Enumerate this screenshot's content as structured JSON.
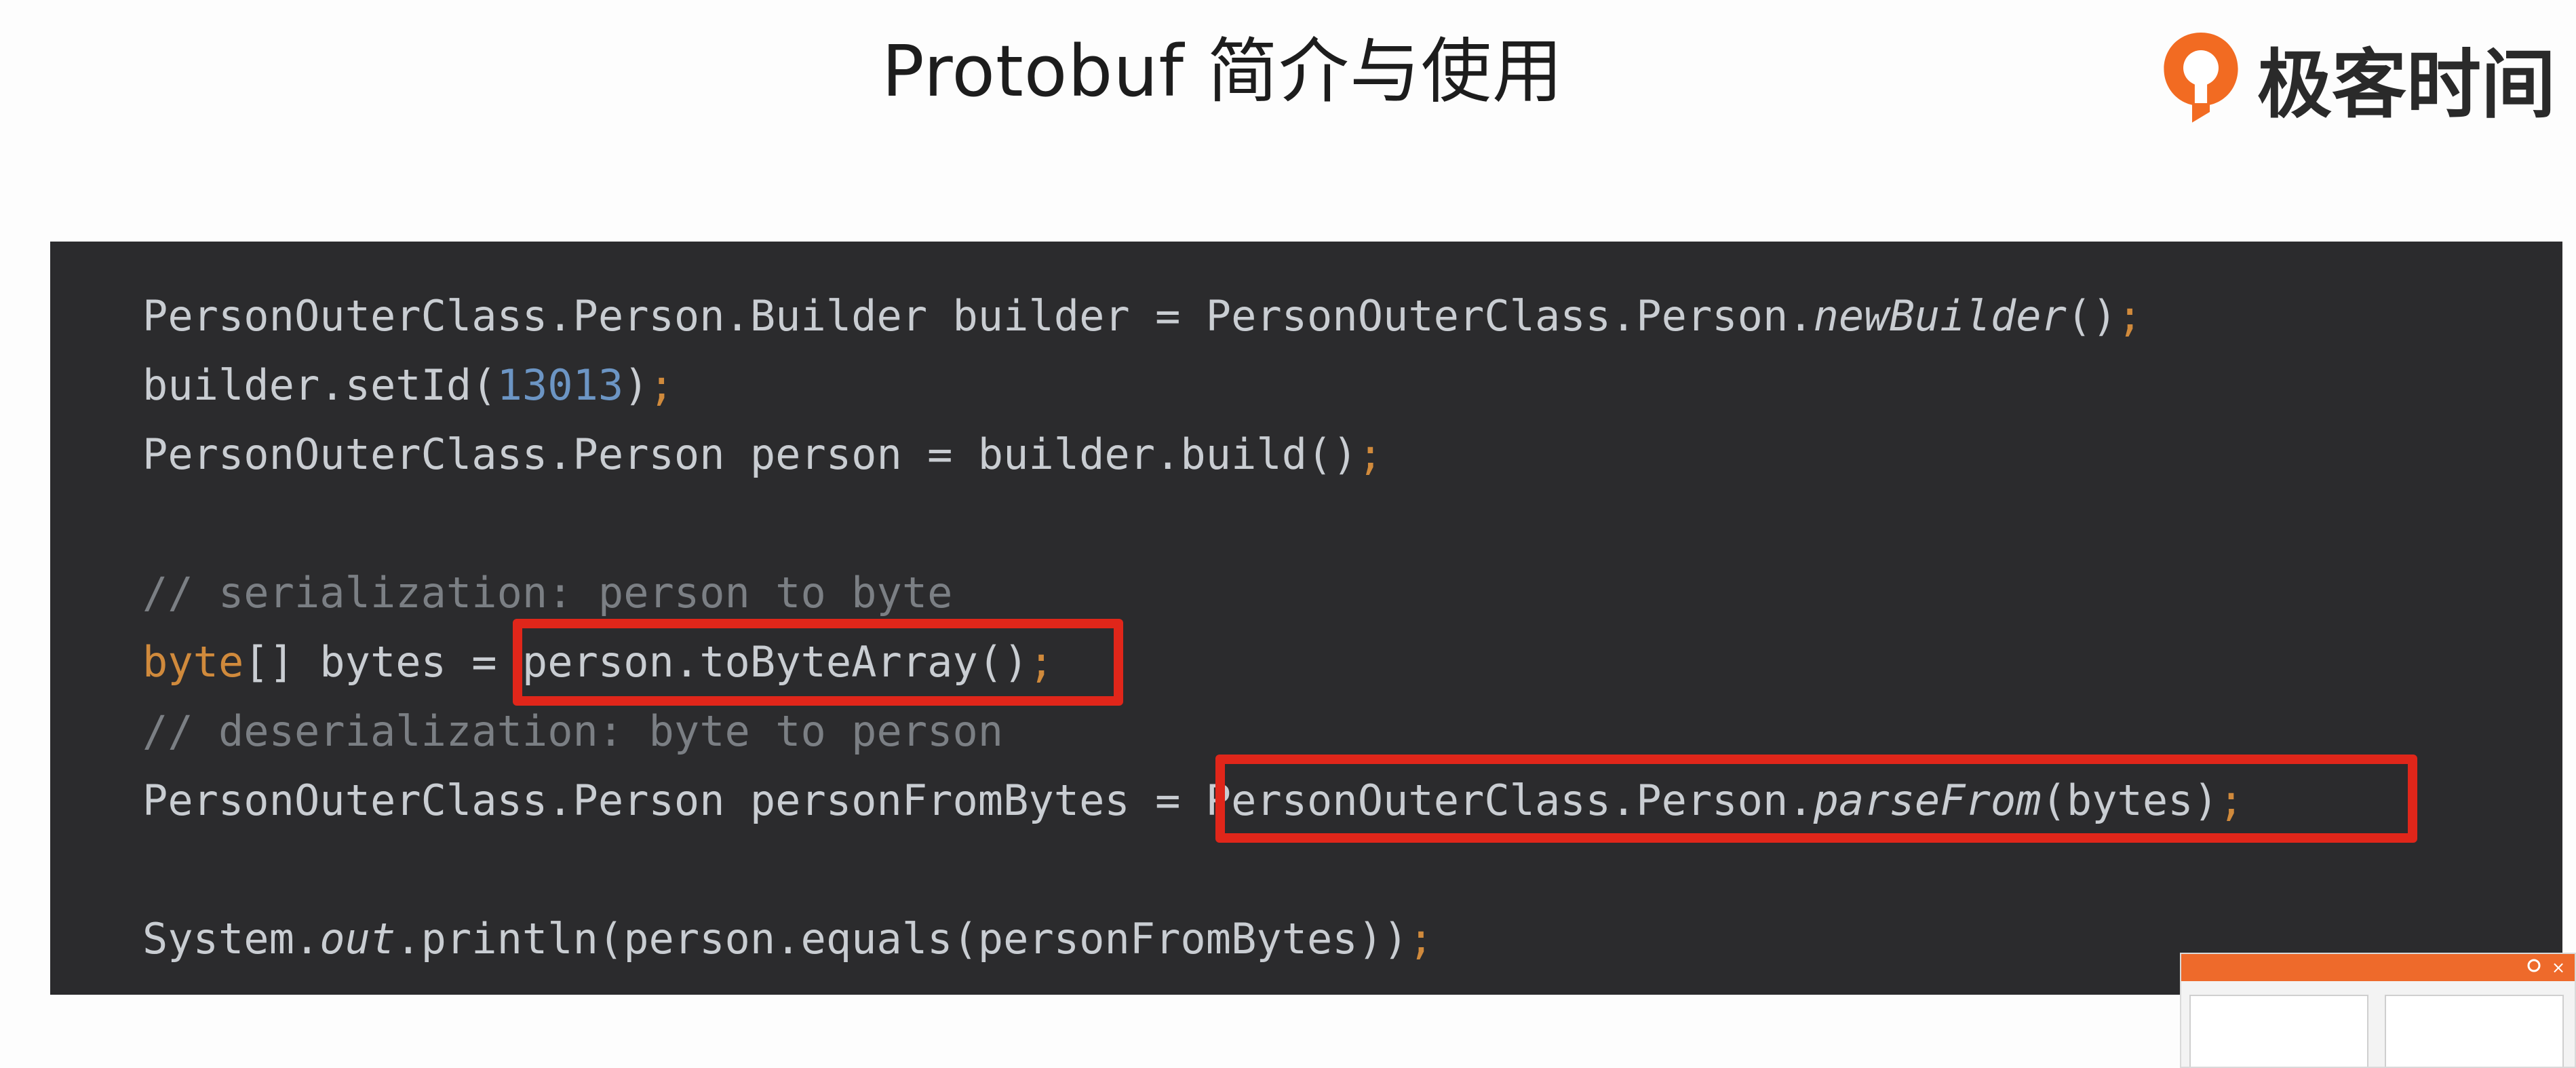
{
  "slide": {
    "title": "Protobuf 简介与使用",
    "brand": {
      "name": "极客时间",
      "logo_icon": "geektime-logo-icon",
      "logo_color": "#f26b22"
    }
  },
  "code": {
    "lines": [
      {
        "parts": [
          "PersonOuterClass.Person.Builder builder = PersonOuterClass.Person.",
          "newBuilder",
          "()",
          ";"
        ]
      },
      {
        "parts": [
          "builder.setId(",
          "13013",
          ")",
          ";"
        ]
      },
      {
        "parts": [
          "PersonOuterClass.Person person = builder.build()",
          ";"
        ]
      },
      {
        "parts": [
          "// serialization: person to byte"
        ]
      },
      {
        "parts": [
          "byte",
          "[] bytes = ",
          "person.toByteArray()",
          ";"
        ]
      },
      {
        "parts": [
          "// deserialization: byte to person"
        ]
      },
      {
        "parts": [
          "PersonOuterClass.Person personFromBytes = ",
          "PersonOuterClass.Person.",
          "parseFrom",
          "(bytes)",
          ";"
        ]
      },
      {
        "parts": [
          "System.",
          "out",
          ".println(person.equals(personFromBytes))",
          ";"
        ]
      }
    ],
    "colors": {
      "background": "#2b2b2d",
      "keyword": "#d08a3c",
      "number": "#6c95c4",
      "comment": "#7b7f84",
      "highlight_box": "#e0261a"
    }
  },
  "thumbnail": {
    "toolbar_color": "#ee6a2b",
    "pin_icon": "pin-icon",
    "close_icon": "close-icon",
    "close_glyph": "×"
  }
}
